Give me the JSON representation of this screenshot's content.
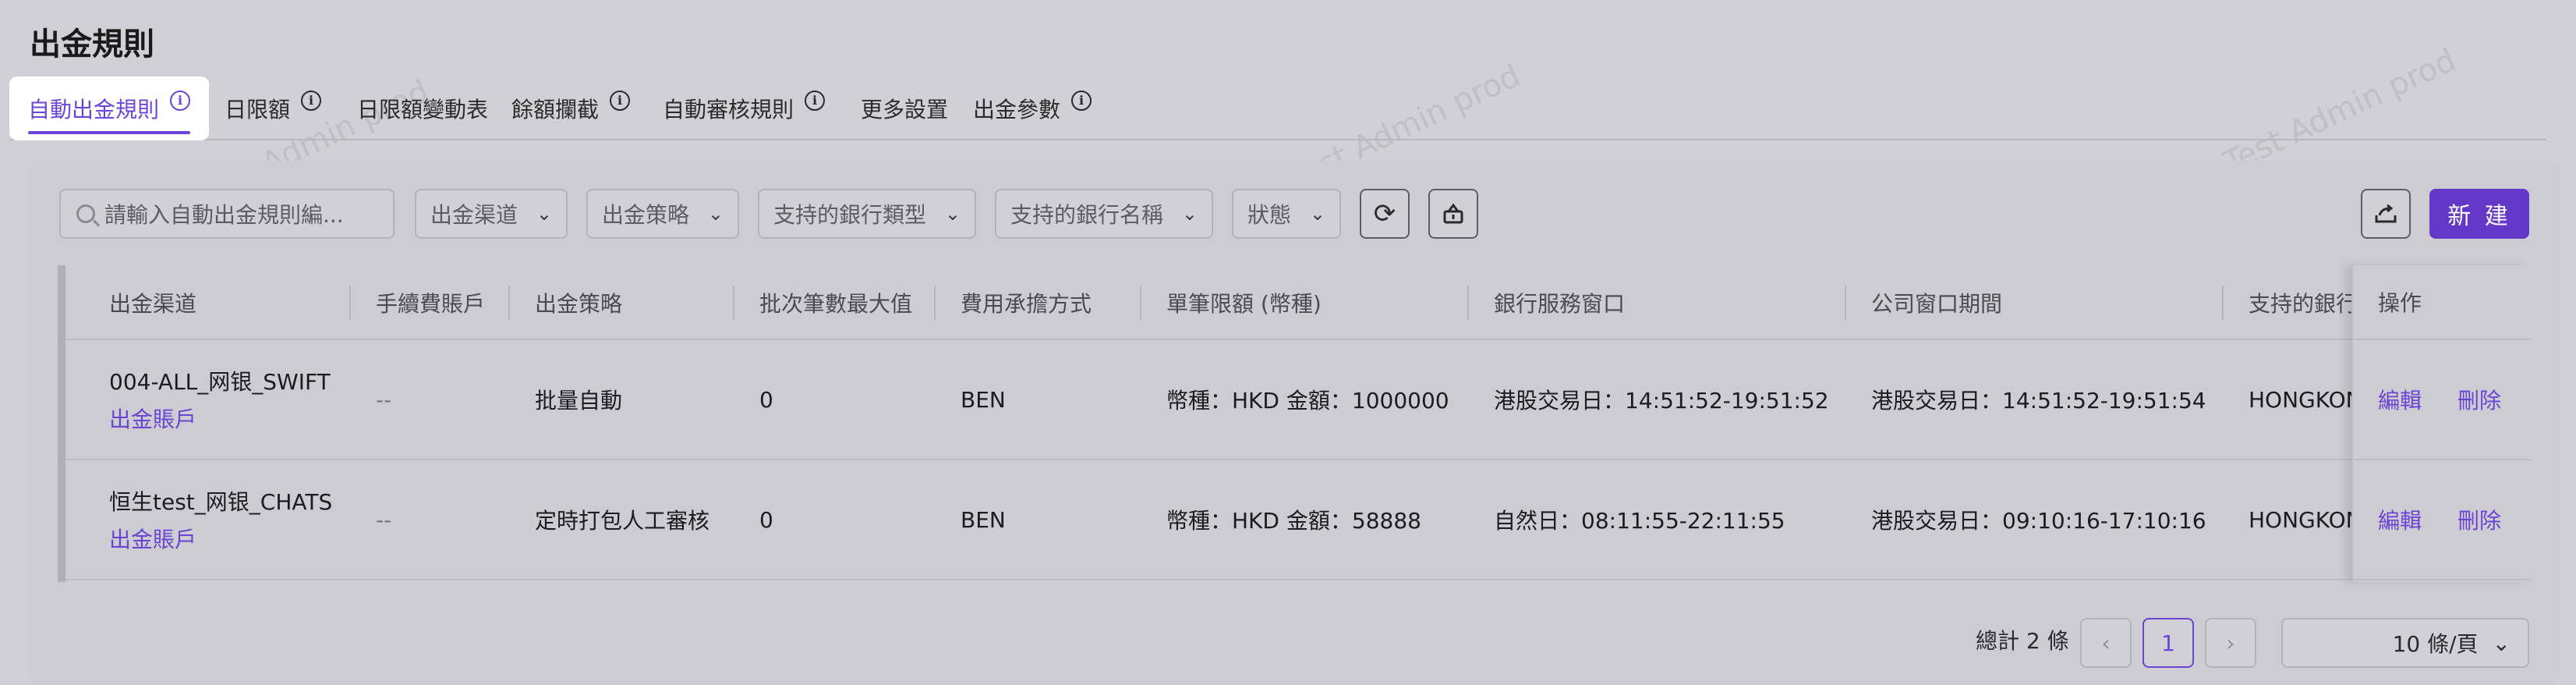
{
  "page": {
    "title": "出金規則"
  },
  "tabs": [
    {
      "label": "自動出金規則",
      "info": true,
      "active": true
    },
    {
      "label": "日限額",
      "info": true
    },
    {
      "label": "日限額變動表",
      "info": false
    },
    {
      "label": "餘額攔截",
      "info": true
    },
    {
      "label": "自動審核規則",
      "info": true
    },
    {
      "label": "更多設置",
      "info": false
    },
    {
      "label": "出金參數",
      "info": true
    }
  ],
  "toolbar": {
    "search_placeholder": "請輸入自動出金規則編...",
    "filters": [
      "出金渠道",
      "出金策略",
      "支持的銀行類型",
      "支持的銀行名稱",
      "狀態"
    ],
    "new_label": "新 建"
  },
  "table": {
    "columns": [
      "出金渠道",
      "手續費賬戶",
      "出金策略",
      "批次筆數最大值",
      "費用承擔方式",
      "單筆限額 (幣種)",
      "銀行服務窗口",
      "公司窗口期間",
      "支持的銀行類"
    ],
    "op_column": "操作",
    "rows": [
      {
        "channel": "004-ALL_网银_SWIFT",
        "account_link": "出金賬戶",
        "fee_account": "--",
        "strategy": "批量自動",
        "batch_max": "0",
        "fee_bearer": "BEN",
        "limit": "幣種：HKD 金額：1000000",
        "bank_window": "港股交易日：14:51:52-19:51:52",
        "company_window": "港股交易日：14:51:52-19:51:54",
        "bank_type": "HONGKONG",
        "edit": "編輯",
        "delete": "刪除"
      },
      {
        "channel": "恒生test_网银_CHATS",
        "account_link": "出金賬戶",
        "fee_account": "--",
        "strategy": "定時打包人工審核",
        "batch_max": "0",
        "fee_bearer": "BEN",
        "limit": "幣種：HKD 金額：58888",
        "bank_window": "自然日：08:11:55-22:11:55",
        "company_window": "港股交易日：09:10:16-17:10:16",
        "bank_type": "HONGKONG",
        "edit": "編輯",
        "delete": "刪除"
      }
    ]
  },
  "pagination": {
    "total": "總計 2 條",
    "prev": "‹",
    "current": "1",
    "next": "›",
    "page_size": "10 條/頁"
  },
  "watermark": "LongPort Test Admin prod"
}
